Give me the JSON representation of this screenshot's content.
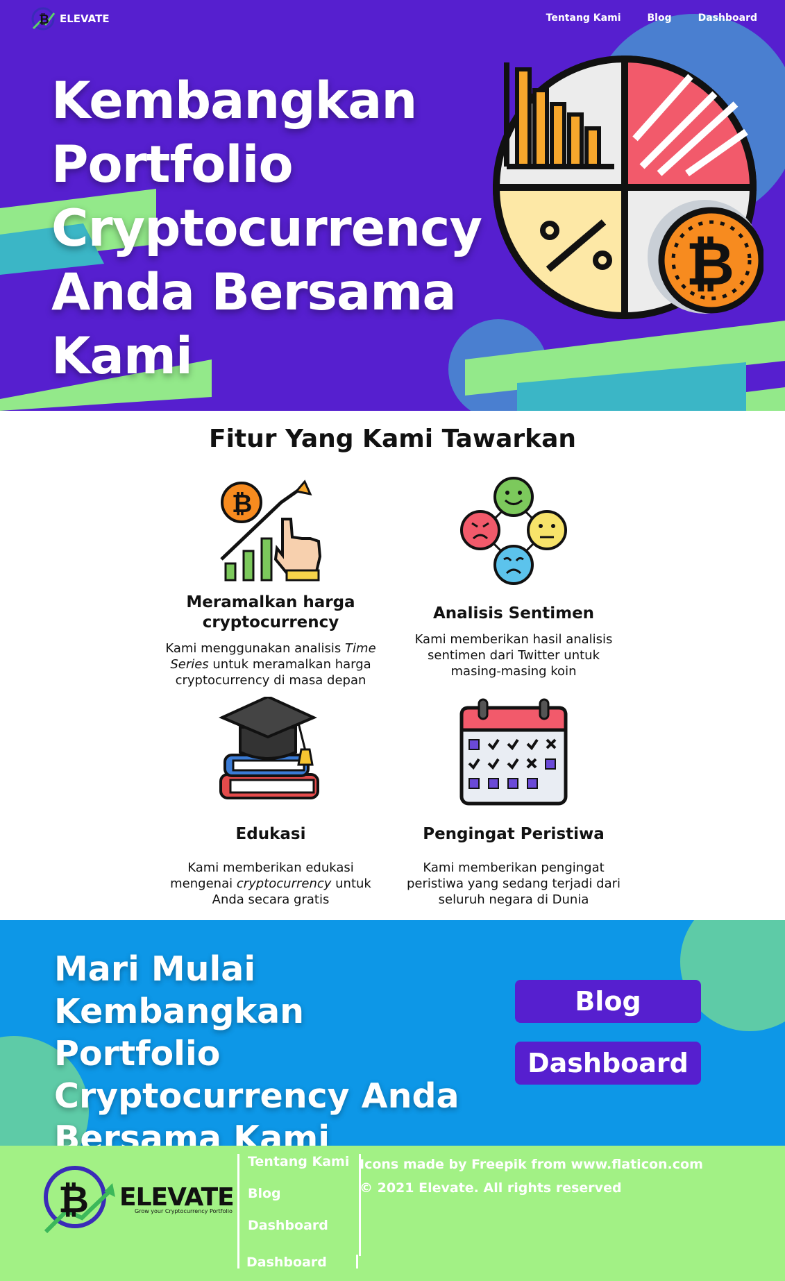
{
  "nav": {
    "brand": "ELEVATE",
    "links": [
      "Tentang Kami",
      "Blog",
      "Dashboard"
    ]
  },
  "hero": {
    "title": "Kembangkan Portfolio Cryptocurrency Anda Bersama Kami"
  },
  "features": {
    "title": "Fitur Yang Kami Tawarkan",
    "items": [
      {
        "icon": "price-growth-chart-icon",
        "title": "Meramalkan harga cryptocurrency",
        "desc_pre": "Kami menggunakan analisis ",
        "desc_em": "Time Series",
        "desc_post": " untuk meramalkan harga cryptocurrency di masa depan"
      },
      {
        "icon": "sentiment-faces-icon",
        "title": "Analisis Sentimen",
        "desc_pre": "Kami memberikan hasil analisis sentimen dari Twitter untuk masing-masing koin",
        "desc_em": "",
        "desc_post": ""
      },
      {
        "icon": "graduation-books-icon",
        "title": "Edukasi",
        "desc_pre": "Kami memberikan edukasi mengenai ",
        "desc_em": "cryptocurrency",
        "desc_post": " untuk Anda secara gratis"
      },
      {
        "icon": "calendar-icon",
        "title": "Pengingat Peristiwa",
        "desc_pre": "Kami memberikan pengingat peristiwa yang sedang terjadi dari seluruh negara di Dunia",
        "desc_em": "",
        "desc_post": ""
      }
    ]
  },
  "cta": {
    "title": "Mari Mulai Kembangkan Portfolio Cryptocurrency Anda Bersama Kami",
    "blog_label": "Blog",
    "dashboard_label": "Dashboard"
  },
  "footer": {
    "brand": "ELEVATE",
    "tagline": "Grow your Cryptocurrency Portfolio",
    "links": [
      "Tentang Kami",
      "Blog",
      "Dashboard"
    ],
    "extra_link": "Dashboard",
    "credit": "Icons made by Freepik from www.flaticon.com",
    "copyright": "© 2021 Elevate. All rights reserved"
  },
  "colors": {
    "hero_bg": "#561fcf",
    "cta_bg": "#0d97e7",
    "footer_bg": "#a2f185",
    "accent_green": "#93e98a",
    "accent_teal": "#3bb6c6",
    "button_bg": "#561fcf"
  }
}
